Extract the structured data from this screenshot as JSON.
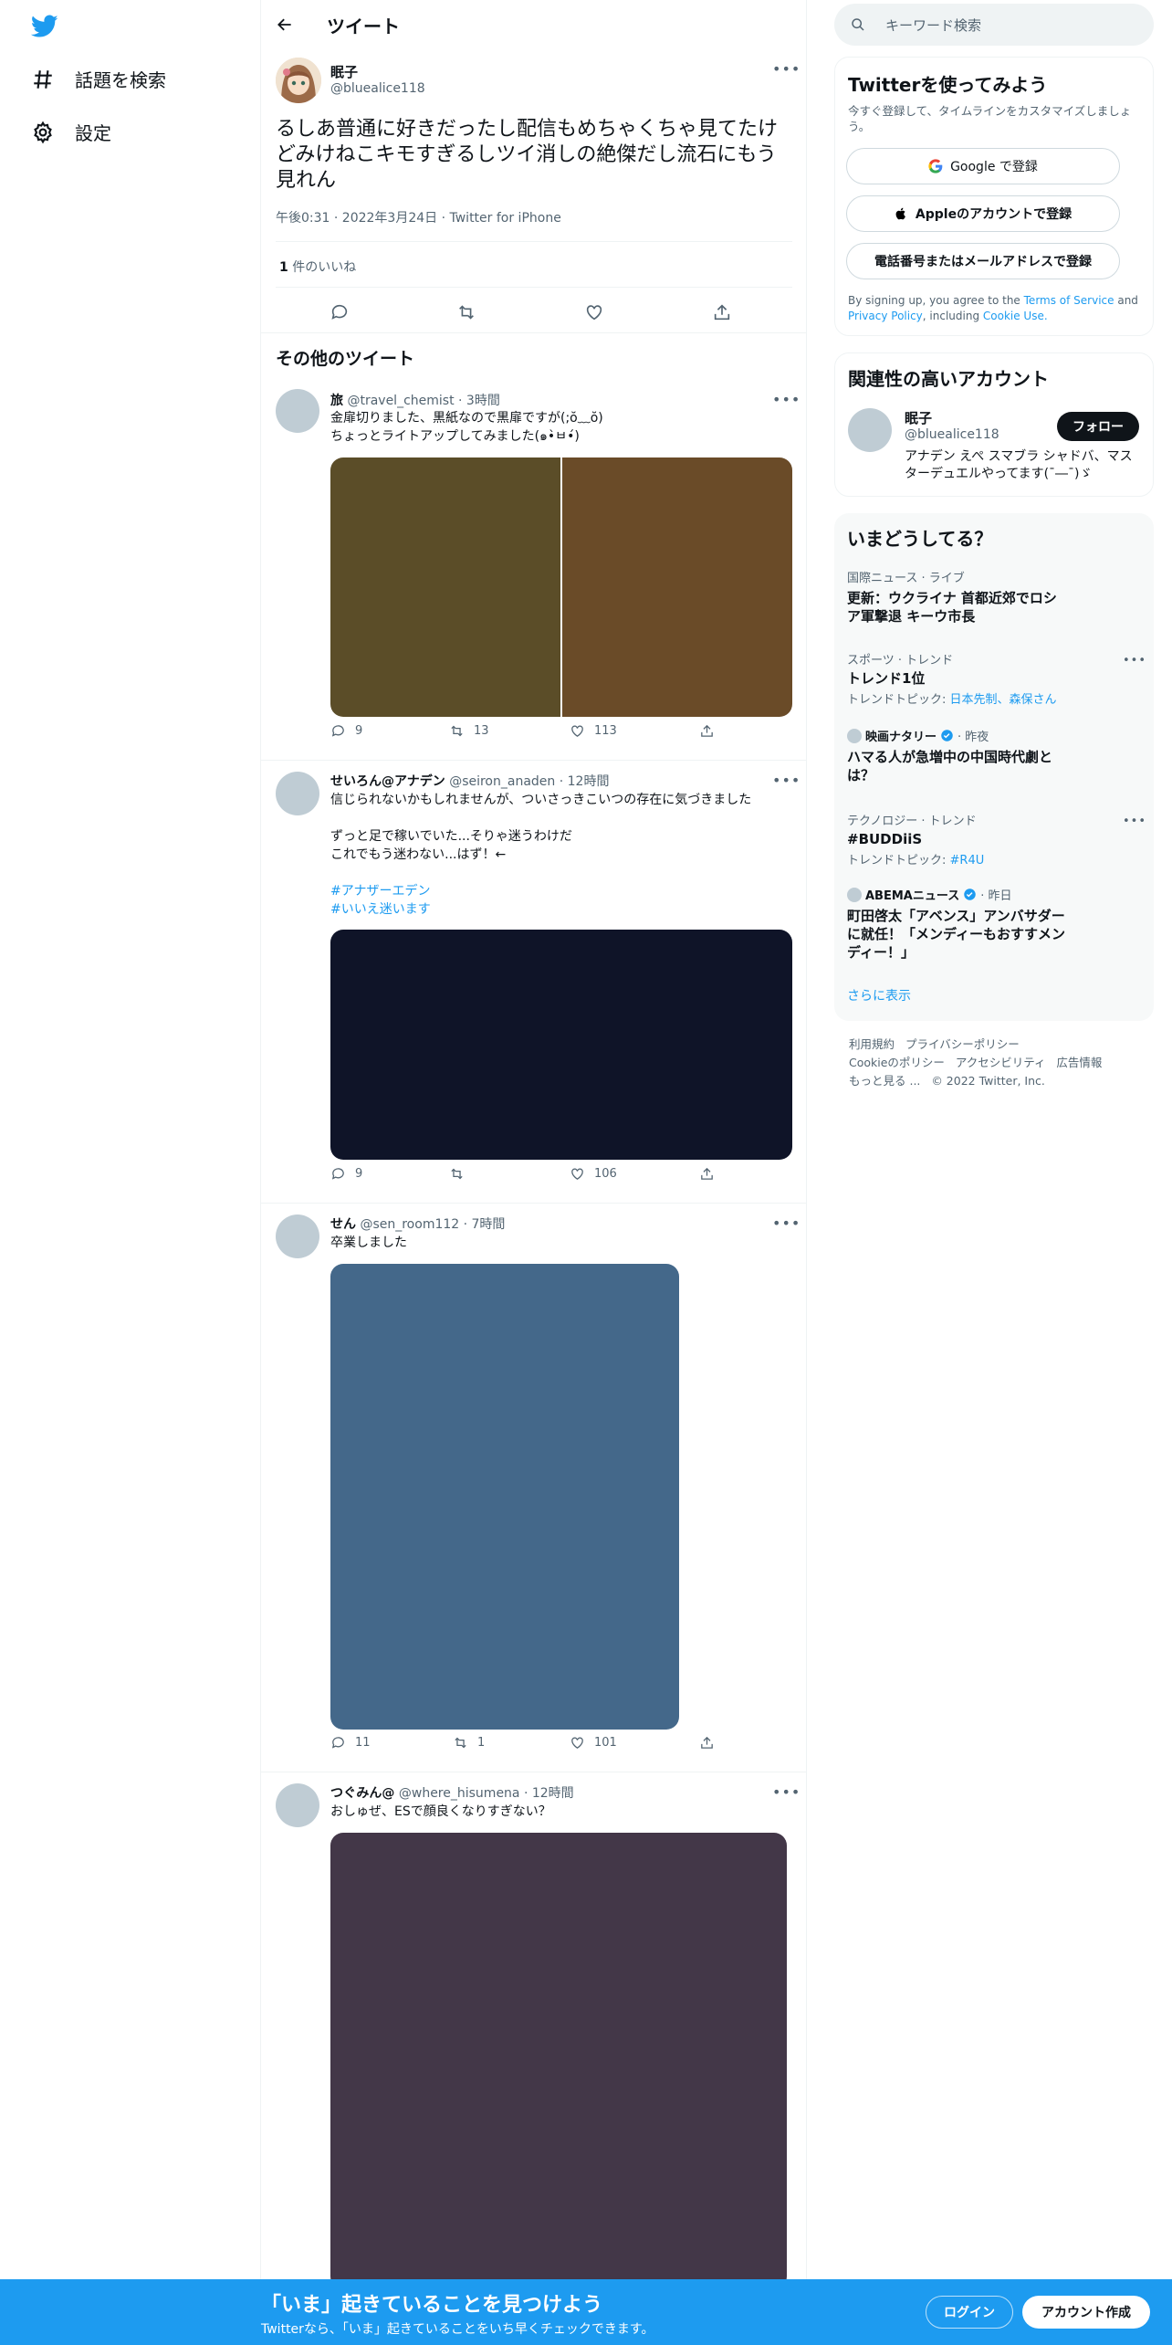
{
  "nav": {
    "explore_label": "話題を検索",
    "settings_label": "設定"
  },
  "header": {
    "title": "ツイート"
  },
  "main_tweet": {
    "name": "眠子",
    "handle": "@bluealice118",
    "text": "るしあ普通に好きだったし配信もめちゃくちゃ見てたけどみけねこキモすぎるしツイ消しの絶傑だし流石にもう見れん",
    "meta": "午後0:31 · 2022年3月24日 · Twitter for iPhone",
    "likes_count": "1",
    "likes_label": "件のいいね"
  },
  "more_tweets_heading": "その他のツイート",
  "tweets": [
    {
      "name": "旅",
      "handle": "@travel_chemist",
      "time": "· 3時間",
      "lines": [
        "金扉切りました、黒紙なので黒扉ですが(;ŏ﹏ŏ)",
        "ちょっとライトアップしてみました(๑•̀ㅂ•́)"
      ],
      "replies": "9",
      "retweets": "13",
      "likes": "113"
    },
    {
      "name": "せいろん@アナデン",
      "handle": "@seiron_anaden",
      "time": "· 12時間",
      "lines": [
        "信じられないかもしれませんが、ついさっきこいつの存在に気づきました",
        "",
        "ずっと足で稼いでいた...そりゃ迷うわけだ",
        "これでもう迷わない...はず！←"
      ],
      "hashtags": [
        "#アナザーエデン",
        "#いいえ迷います"
      ],
      "replies": "9",
      "retweets": "",
      "likes": "106"
    },
    {
      "name": "せん",
      "handle": "@sen_room112",
      "time": "· 7時間",
      "lines": [
        "卒業しました"
      ],
      "replies": "11",
      "retweets": "1",
      "likes": "101"
    },
    {
      "name": "つぐみん@",
      "handle": "@where_hisumena",
      "time": "· 12時間",
      "lines": [
        "おしゅぜ、ESで顔良くなりすぎない？"
      ]
    }
  ],
  "search": {
    "placeholder": "キーワード検索"
  },
  "signup": {
    "title": "Twitterを使ってみよう",
    "subtitle": "今すぐ登録して、タイムラインをカスタマイズしましょう。",
    "google_label": "Google で登録",
    "apple_label": "Appleのアカウントで登録",
    "phone_label": "電話番号またはメールアドレスで登録",
    "terms_prefix": "By signing up, you agree to the ",
    "terms_link": "Terms of Service",
    "terms_and": " and",
    "privacy_link": "Privacy Policy",
    "terms_including": ", including ",
    "cookie_link": "Cookie Use."
  },
  "relevant": {
    "title": "関連性の高いアカウント",
    "name": "眠子",
    "handle": "@bluealice118",
    "bio": "アナデン えぺ スマブラ シャドバ、マスターデュエルやってます(¯―¯)ゞ",
    "follow_label": "フォロー"
  },
  "trends": {
    "title": "いまどうしてる？",
    "items": [
      {
        "category": "国際ニュース · ライブ",
        "title": "更新：ウクライナ 首都近郊でロシア軍撃退 キーウ市長"
      },
      {
        "category": "スポーツ · トレンド",
        "title": "トレンド1位",
        "topic_prefix": "トレンドトピック: ",
        "topic_links": "日本先制、森保さん"
      },
      {
        "source": "映画ナタリー",
        "time": "· 昨夜",
        "title": "ハマる人が急増中の中国時代劇とは？"
      },
      {
        "category": "テクノロジー · トレンド",
        "title": "#BUDDiiS",
        "topic_prefix": "トレンドトピック: ",
        "topic_links": "#R4U"
      },
      {
        "source": "ABEMAニュース",
        "time": "· 昨日",
        "title": "町田啓太「アベンス」アンバサダーに就任！「メンディーもおすすメンディー！」"
      }
    ],
    "show_more": "さらに表示"
  },
  "footer": {
    "line1": [
      "利用規約",
      "プライバシーポリシー"
    ],
    "line2": [
      "Cookieのポリシー",
      "アクセシビリティ",
      "広告情報"
    ],
    "more": "もっと見る ...",
    "copyright": "© 2022 Twitter, Inc."
  },
  "bottom_bar": {
    "title": "「いま」起きていることを見つけよう",
    "subtitle": "Twitterなら、「いま」起きていることをいち早くチェックできます。",
    "login_label": "ログイン",
    "signup_label": "アカウント作成"
  },
  "colors": {
    "accent": "#1d9bf0",
    "media1_left": "#5b4d28",
    "media1_right": "#6a4b28",
    "media2": "#0f1428",
    "media3": "#44688a",
    "media4": "#433748"
  }
}
